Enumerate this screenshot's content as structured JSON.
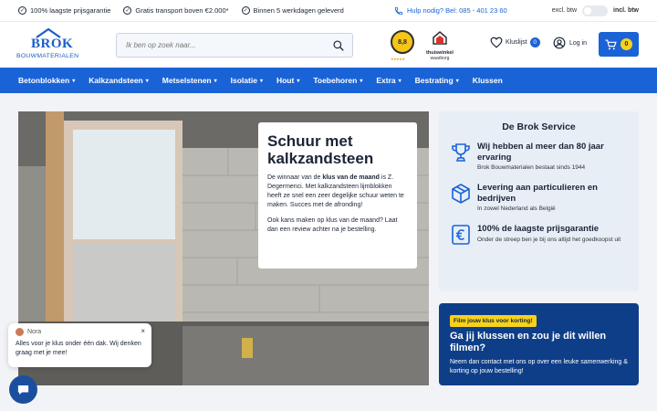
{
  "usp_bar": {
    "items": [
      "100% laagste prijsgarantie",
      "Gratis transport boven €2.000*",
      "Binnen 5 werkdagen geleverd"
    ],
    "help": "Hulp nodig? Bel: 085 - 401 23 60",
    "excl_btw": "excl. btw",
    "incl_btw": "incl. btw"
  },
  "header": {
    "logo_brand": "BROK",
    "logo_sub": "BOUWMATERIALEN",
    "search_placeholder": "Ik ben op zoek naar...",
    "rating": "8,8",
    "thuiswinkel_1": "thuiswinkel",
    "thuiswinkel_2": "waarborg",
    "wishlist_label": "Kluslijst",
    "wishlist_count": "0",
    "login_label": "Log in",
    "cart_count": "0"
  },
  "nav": {
    "items": [
      {
        "label": "Betonblokken",
        "dropdown": true
      },
      {
        "label": "Kalkzandsteen",
        "dropdown": true
      },
      {
        "label": "Metselstenen",
        "dropdown": true
      },
      {
        "label": "Isolatie",
        "dropdown": true
      },
      {
        "label": "Hout",
        "dropdown": true
      },
      {
        "label": "Toebehoren",
        "dropdown": true
      },
      {
        "label": "Extra",
        "dropdown": true
      },
      {
        "label": "Bestrating",
        "dropdown": true
      },
      {
        "label": "Klussen",
        "dropdown": false
      }
    ]
  },
  "hero": {
    "title": "Schuur met kalkzandsteen",
    "p1_before": "De winnaar van de ",
    "p1_bold": "klus van de maand",
    "p1_after": " is Z. Degermenci. Met kalkzandsteen lijmblokken heeft ze snel een zeer degelijke schuur weten te maken. Succes met de afronding!",
    "p2": "Ook kans maken op klus van de maand? Laat dan een review achter na je bestelling."
  },
  "service": {
    "title": "De Brok Service",
    "items": [
      {
        "icon": "trophy-icon",
        "title": "Wij hebben al meer dan 80 jaar ervaring",
        "desc": "Brok Bouwmaterialen bestaat sinds 1944"
      },
      {
        "icon": "delivery-box-icon",
        "title": "Levering aan particulieren en bedrijven",
        "desc": "In zowel Nederland als België"
      },
      {
        "icon": "euro-icon",
        "title": "100% de laagste prijsgarantie",
        "desc": "Onder de streep ben je bij ons altijd het goedkoopst uit"
      }
    ]
  },
  "promo": {
    "tag": "Film jouw klus voor korting!",
    "title": "Ga jij klussen en zou je dit willen filmen?",
    "text": "Neem dan contact met ons op over een leuke samenwerking & korting op jouw bestelling!"
  },
  "chat": {
    "agent": "Nora",
    "message": "Alles voor je klus onder één dak. Wij denken graag met je mee!",
    "close": "×"
  },
  "colors": {
    "primary": "#1a63d6",
    "dark_navy": "#0f3e88",
    "yellow": "#f7d21c"
  }
}
